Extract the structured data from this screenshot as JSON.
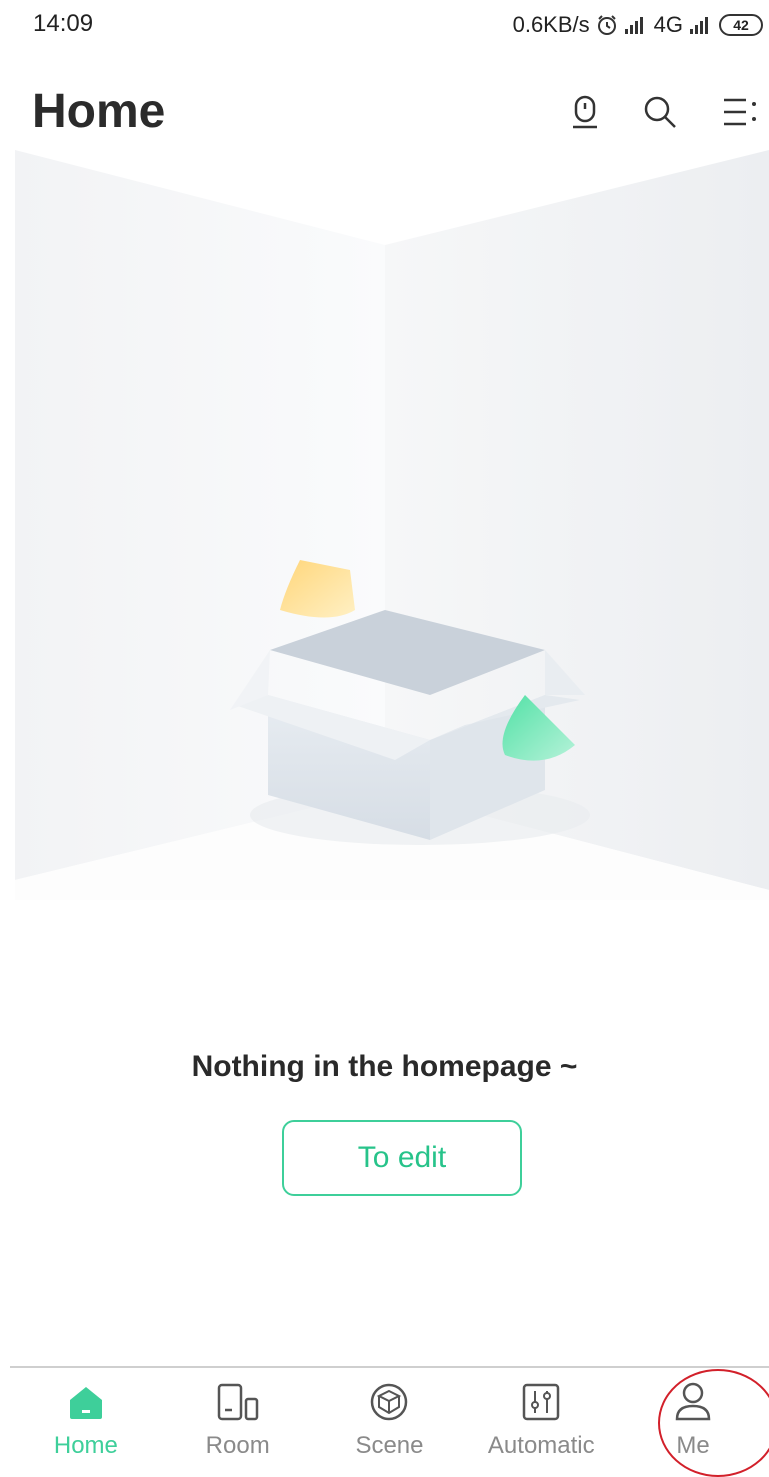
{
  "status_bar": {
    "time": "14:09",
    "network_speed": "0.6KB/s",
    "network_type": "4G",
    "battery": "42",
    "icons": [
      "alarm-icon",
      "signal-icon",
      "signal-icon-secondary",
      "battery-icon"
    ]
  },
  "header": {
    "title": "Home",
    "icons": [
      "device-icon",
      "search-icon",
      "menu-icon"
    ]
  },
  "empty_state": {
    "message": "Nothing in the homepage ~",
    "edit_button_label": "To edit",
    "illustration_icon": "empty-box-illustration"
  },
  "bottom_nav": {
    "items": [
      {
        "label": "Home",
        "icon": "home-icon",
        "active": true
      },
      {
        "label": "Room",
        "icon": "room-icon",
        "active": false
      },
      {
        "label": "Scene",
        "icon": "scene-icon",
        "active": false
      },
      {
        "label": "Automatic",
        "icon": "automatic-icon",
        "active": false
      },
      {
        "label": "Me",
        "icon": "me-icon",
        "active": false
      }
    ]
  },
  "colors": {
    "accent": "#3ecf9a",
    "text_primary": "#2b2b2b",
    "text_secondary": "#8a8a8a",
    "annotation": "#d2202a"
  }
}
